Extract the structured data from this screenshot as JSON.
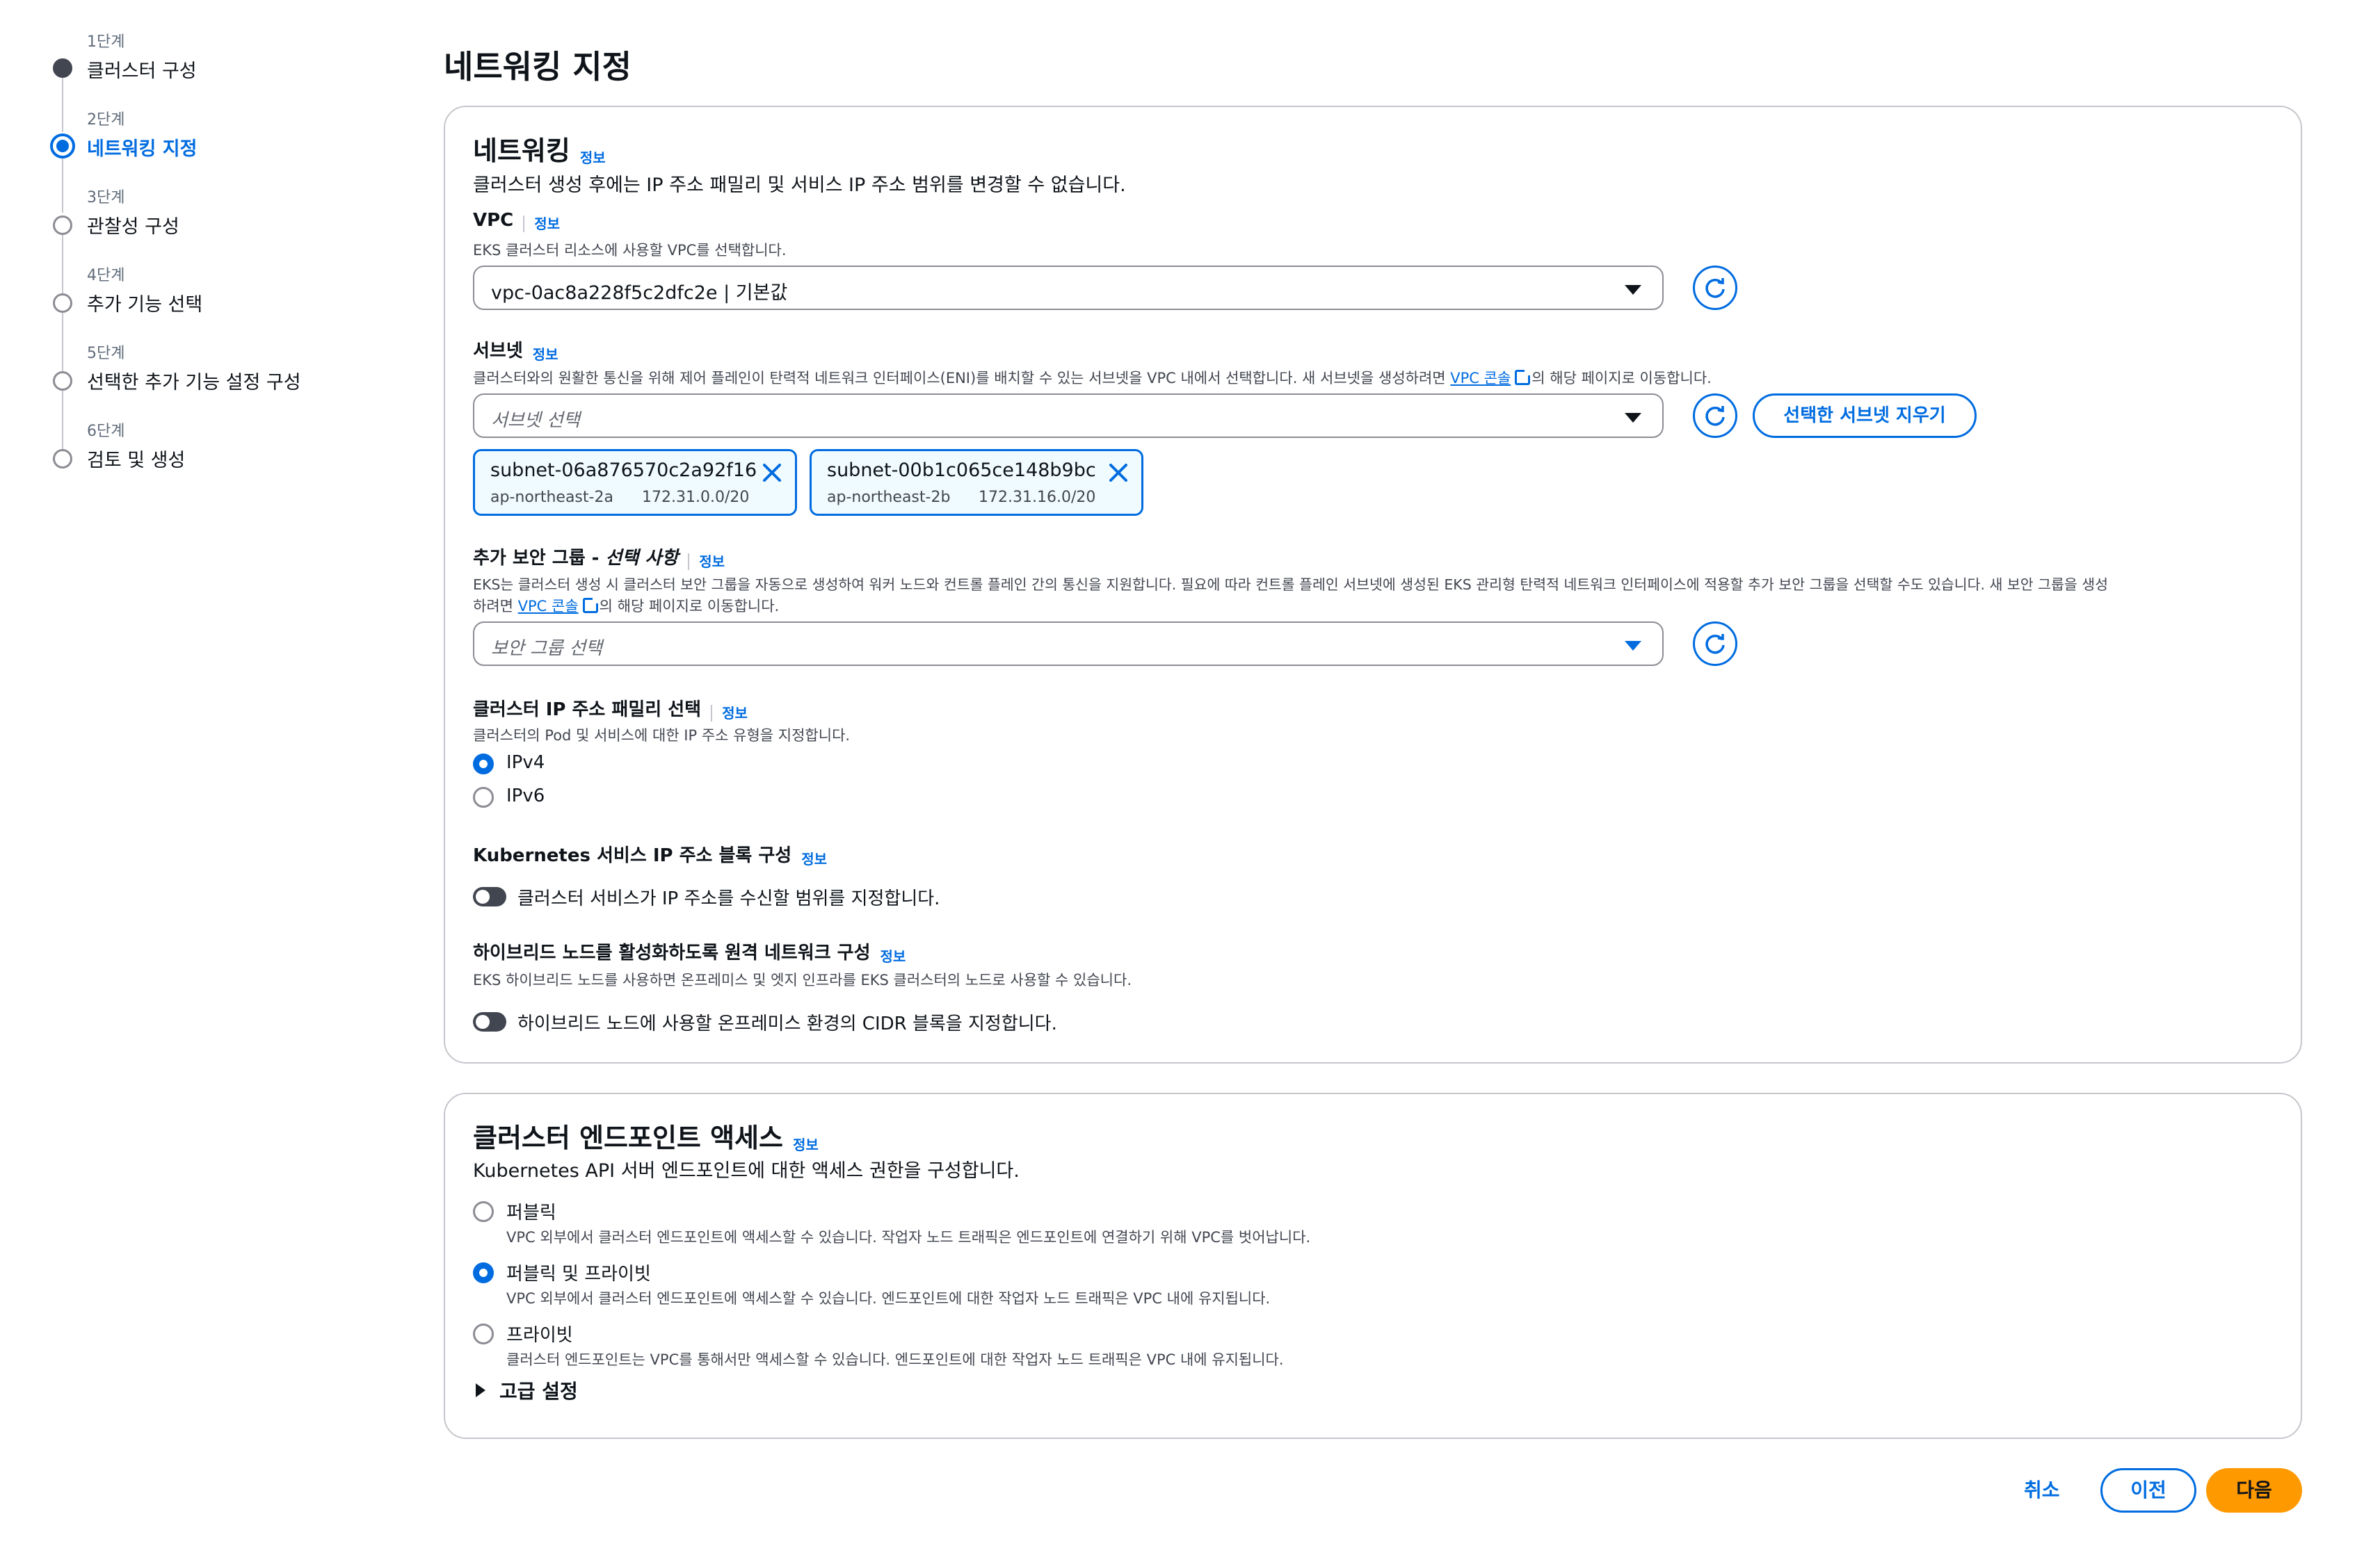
{
  "stepper": [
    {
      "num": "1단계",
      "label": "클러스터 구성",
      "state": "done"
    },
    {
      "num": "2단계",
      "label": "네트워킹 지정",
      "state": "current"
    },
    {
      "num": "3단계",
      "label": "관찰성 구성",
      "state": "pending"
    },
    {
      "num": "4단계",
      "label": "추가 기능 선택",
      "state": "pending"
    },
    {
      "num": "5단계",
      "label": "선택한 추가 기능 설정 구성",
      "state": "pending"
    },
    {
      "num": "6단계",
      "label": "검토 및 생성",
      "state": "pending"
    }
  ],
  "page_title": "네트워킹 지정",
  "info_label": "정보",
  "networking": {
    "title": "네트워킹",
    "description": "클러스터 생성 후에는 IP 주소 패밀리 및 서비스 IP 주소 범위를 변경할 수 없습니다.",
    "vpc": {
      "label": "VPC",
      "description": "EKS 클러스터 리소스에 사용할 VPC를 선택합니다.",
      "selected": "vpc-0ac8a228f5c2dfc2e | 기본값"
    },
    "subnets": {
      "label": "서브넷",
      "description_before": "클러스터와의 원활한 통신을 위해 제어 플레인이 탄력적 네트워크 인터페이스(ENI)를 배치할 수 있는 서브넷을 VPC 내에서 선택합니다. 새 서브넷을 생성하려면 ",
      "link": "VPC 콘솔",
      "description_after": "의 해당 페이지로 이동합니다.",
      "placeholder": "서브넷 선택",
      "clear_button": "선택한 서브넷 지우기",
      "tokens": [
        {
          "name": "subnet-06a876570c2a92f16",
          "az": "ap-northeast-2a",
          "cidr": "172.31.0.0/20"
        },
        {
          "name": "subnet-00b1c065ce148b9bc",
          "az": "ap-northeast-2b",
          "cidr": "172.31.16.0/20"
        }
      ]
    },
    "security_groups": {
      "label": "추가 보안 그룹 - ",
      "label_optional": "선택 사항",
      "description_line1": "EKS는 클러스터 생성 시 클러스터 보안 그룹을 자동으로 생성하여 워커 노드와 컨트롤 플레인 간의 통신을 지원합니다. 필요에 따라 컨트롤 플레인 서브넷에 생성된 EKS 관리형 탄력적 네트워크 인터페이스에 적용할 추가 보안 그룹을 선택할 수도 있습니다. 새 보안 그룹을 생성",
      "description_line2_before": "하려면 ",
      "link": "VPC 콘솔",
      "description_line2_after": "의 해당 페이지로 이동합니다.",
      "placeholder": "보안 그룹 선택"
    },
    "ip_family": {
      "label": "클러스터 IP 주소 패밀리 선택",
      "description": "클러스터의 Pod 및 서비스에 대한 IP 주소 유형을 지정합니다.",
      "options": [
        "IPv4",
        "IPv6"
      ],
      "selected": "IPv4"
    },
    "k8s_service_ip": {
      "label": "Kubernetes 서비스 IP 주소 블록 구성",
      "toggle_label": "클러스터 서비스가 IP 주소를 수신할 범위를 지정합니다.",
      "enabled": false
    },
    "hybrid": {
      "label": "하이브리드 노드를 활성화하도록 원격 네트워크 구성",
      "description": "EKS 하이브리드 노드를 사용하면 온프레미스 및 엣지 인프라를 EKS 클러스터의 노드로 사용할 수 있습니다.",
      "toggle_label": "하이브리드 노드에 사용할 온프레미스 환경의 CIDR 블록을 지정합니다.",
      "enabled": false
    }
  },
  "endpoint": {
    "title": "클러스터 엔드포인트 액세스",
    "description": "Kubernetes API 서버 엔드포인트에 대한 액세스 권한을 구성합니다.",
    "options": [
      {
        "label": "퍼블릭",
        "description": "VPC 외부에서 클러스터 엔드포인트에 액세스할 수 있습니다. 작업자 노드 트래픽은 엔드포인트에 연결하기 위해 VPC를 벗어납니다."
      },
      {
        "label": "퍼블릭 및 프라이빗",
        "description": "VPC 외부에서 클러스터 엔드포인트에 액세스할 수 있습니다. 엔드포인트에 대한 작업자 노드 트래픽은 VPC 내에 유지됩니다."
      },
      {
        "label": "프라이빗",
        "description": "클러스터 엔드포인트는 VPC를 통해서만 액세스할 수 있습니다. 엔드포인트에 대한 작업자 노드 트래픽은 VPC 내에 유지됩니다."
      }
    ],
    "selected": "퍼블릭 및 프라이빗",
    "advanced": "고급 설정"
  },
  "footer": {
    "cancel": "취소",
    "previous": "이전",
    "next": "다음"
  },
  "colors": {
    "accent": "#006ce0",
    "primary_button": "#ff9900",
    "border": "#c6c6cd"
  }
}
